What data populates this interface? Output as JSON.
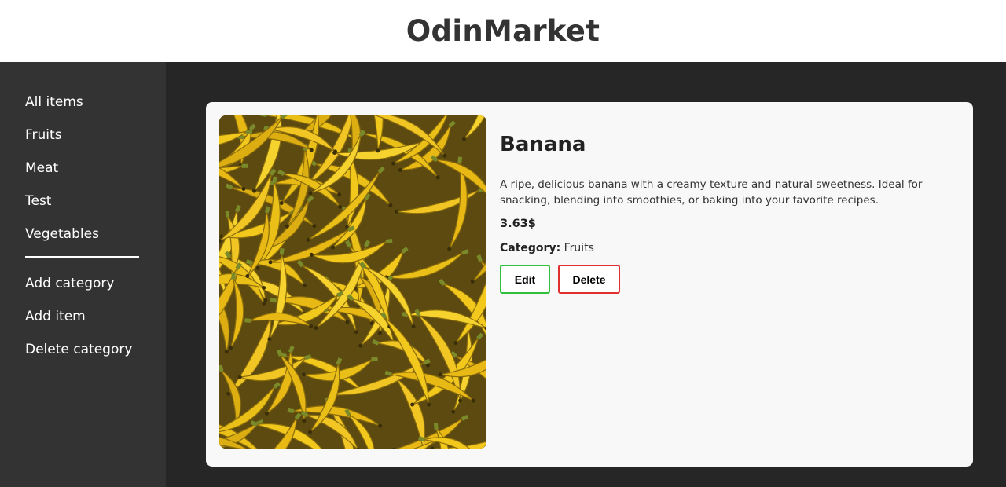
{
  "header": {
    "title": "OdinMarket"
  },
  "sidebar": {
    "categories": [
      "All items",
      "Fruits",
      "Meat",
      "Test",
      "Vegetables"
    ],
    "actions": [
      "Add category",
      "Add item",
      "Delete category"
    ]
  },
  "product": {
    "name": "Banana",
    "image_subject": "pile of ripe bananas",
    "description": "A ripe, delicious banana with a creamy texture and natural sweetness. Ideal for snacking, blending into smoothies, or baking into your favorite recipes.",
    "price": "3.63$",
    "category_label": "Category:",
    "category_value": "Fruits",
    "edit_label": "Edit",
    "delete_label": "Delete"
  },
  "colors": {
    "edit_border": "#2fbf3a",
    "delete_border": "#e02f2f",
    "sidebar_bg": "#333333",
    "main_bg": "#262626"
  }
}
